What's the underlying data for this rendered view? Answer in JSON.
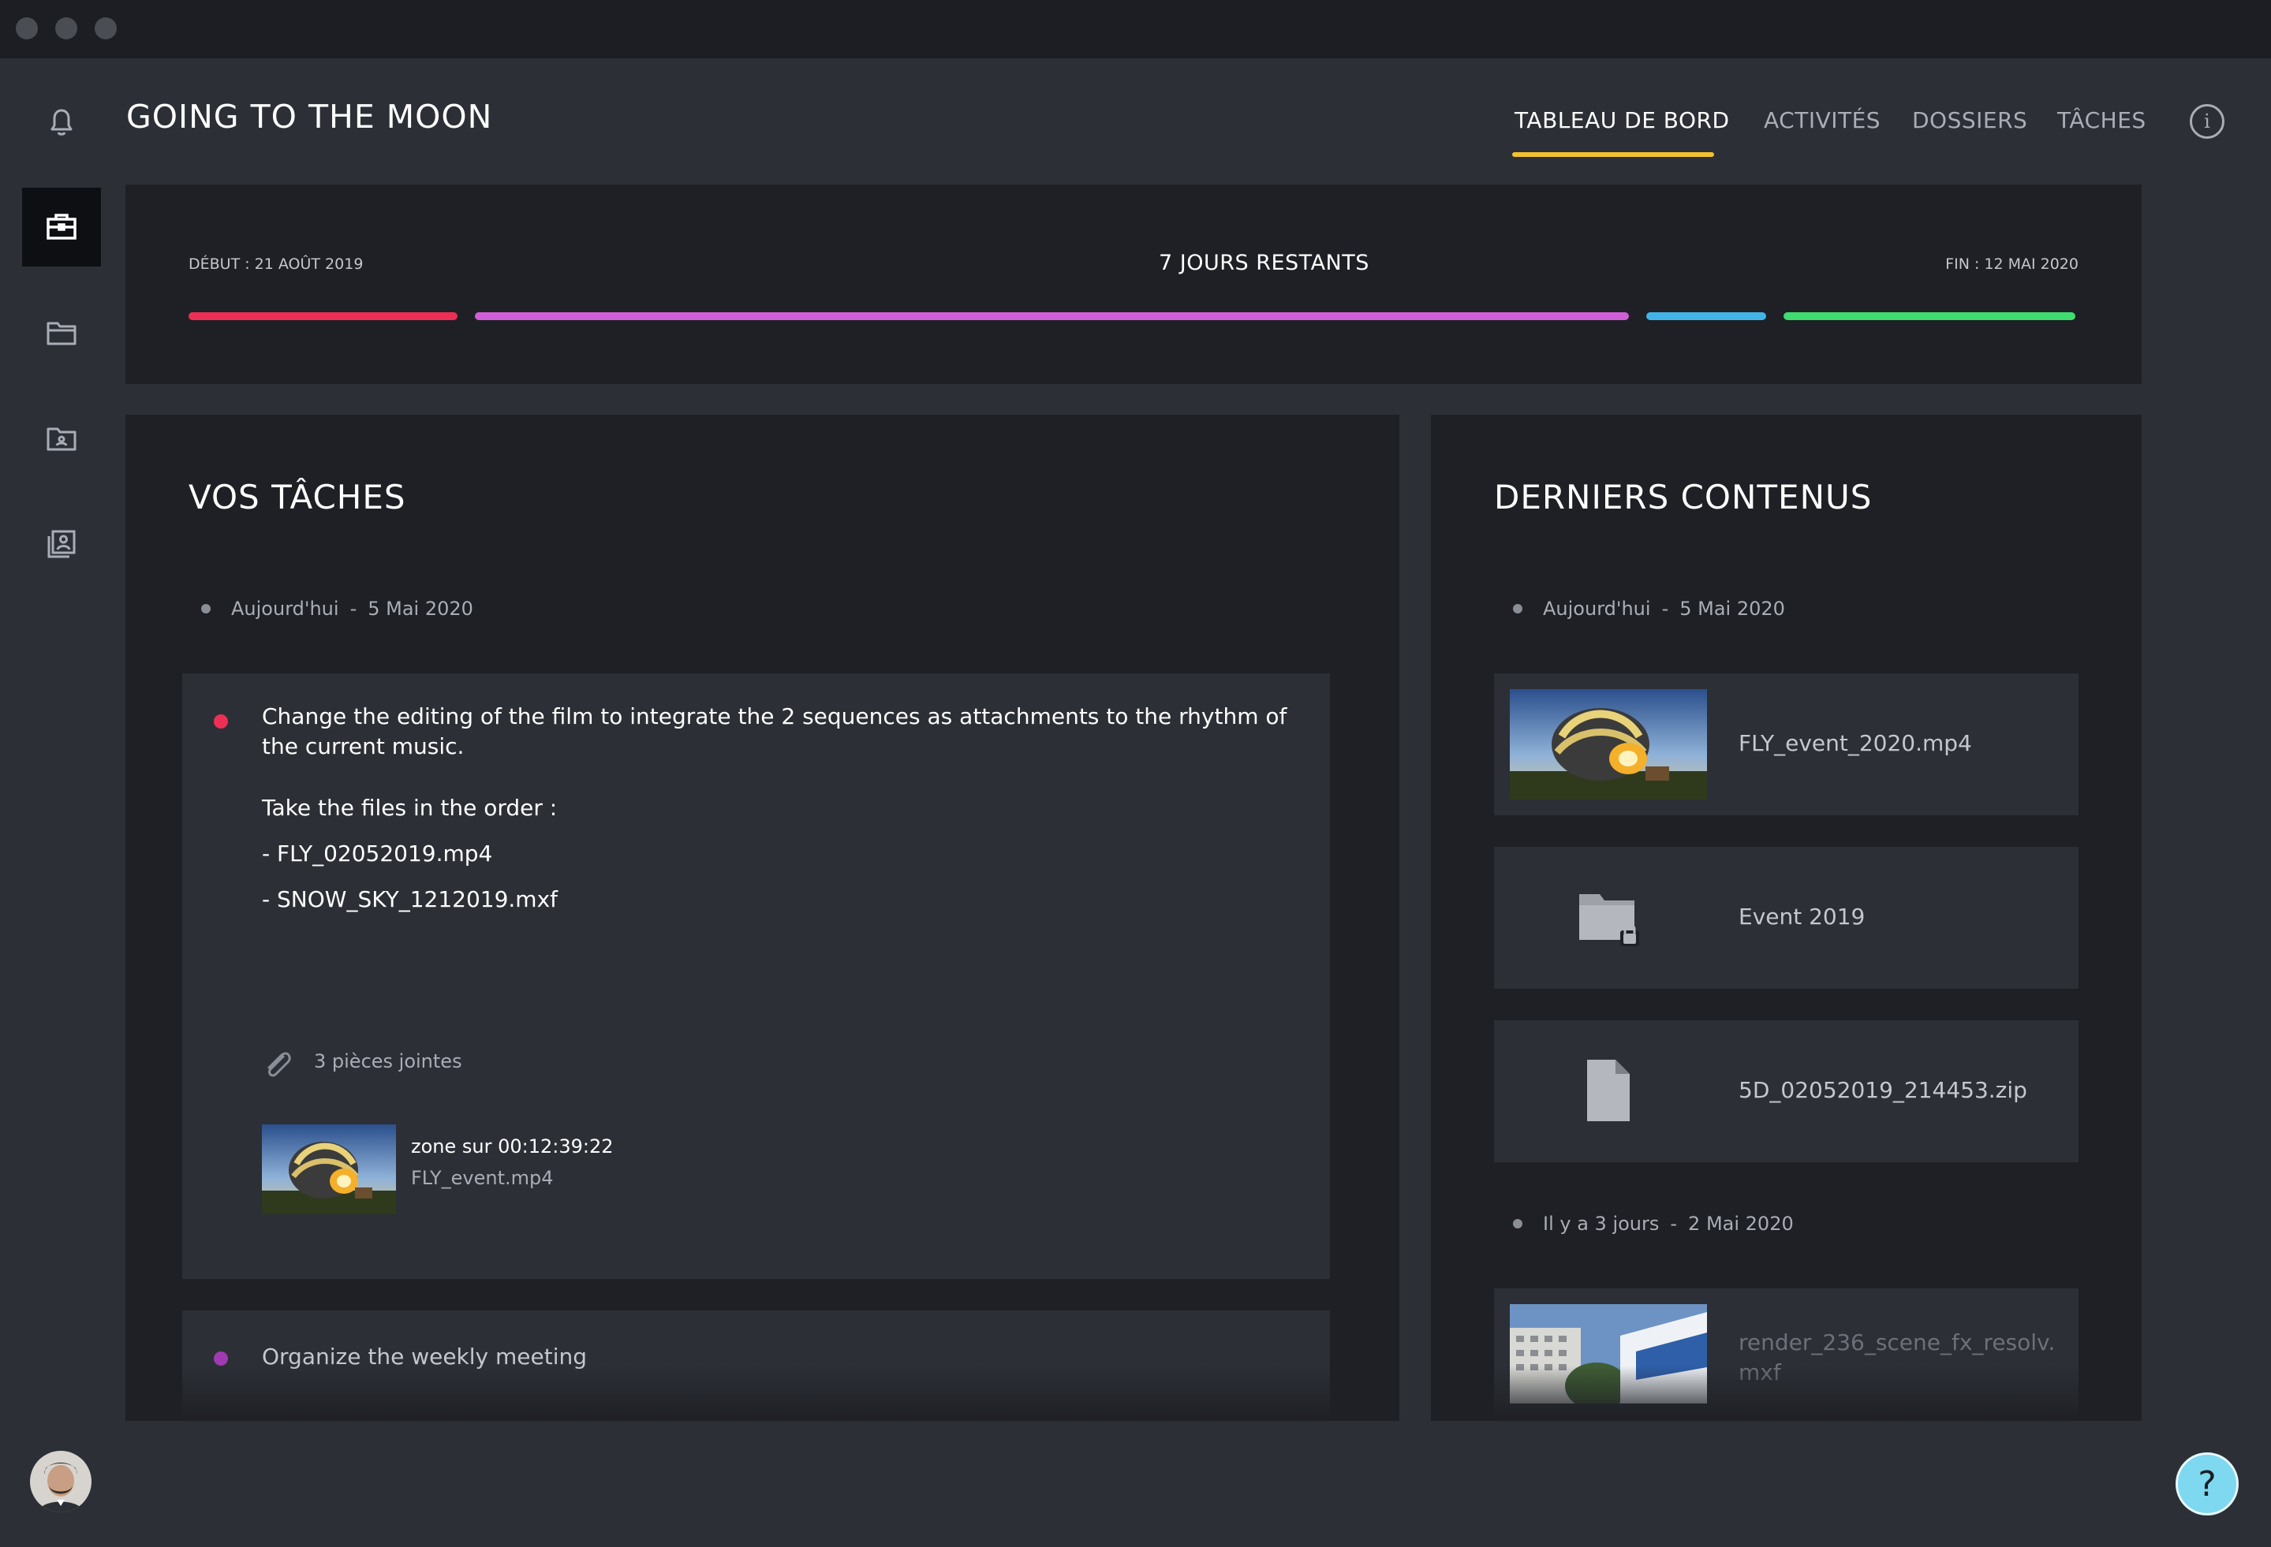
{
  "header": {
    "title": "GOING TO THE MOON",
    "nav": [
      "TABLEAU DE BORD",
      "ACTIVITÉS",
      "DOSSIERS",
      "TÂCHES"
    ],
    "info_glyph": "i"
  },
  "timeline": {
    "start": "DÉBUT : 21 AOÛT 2019",
    "end": "FIN : 12 MAI 2020",
    "remaining": "7 JOURS RESTANTS",
    "phase_colors": [
      "#ee2f55",
      "#cf5fd8",
      "#42b3e6",
      "#3fdc6f"
    ]
  },
  "tasks": {
    "title": "VOS TÂCHES",
    "date_label": "Aujourd'hui",
    "date_sep": "-",
    "date_value": "5 Mai 2020",
    "items": [
      {
        "text": "Change the editing of the film to integrate the 2 sequences as attachments to the rhythm of the current music.",
        "order_label": "Take the files in the order :",
        "file1": "- FLY_02052019.mp4",
        "file2": "- SNOW_SKY_1212019.mxf",
        "attachments": "3 pièces jointes",
        "attachment_zone": "zone sur 00:12:39:22",
        "attachment_file": "FLY_event.mp4",
        "dot_color": "#ee2f55"
      },
      {
        "text": "Organize the weekly meeting",
        "dot_color": "#a03ab0"
      }
    ]
  },
  "contents": {
    "title": "DERNIERS CONTENUS",
    "group1": {
      "label": "Aujourd'hui",
      "sep": "-",
      "date": "5 Mai 2020"
    },
    "items": [
      {
        "name": "FLY_event_2020.mp4",
        "icon": "video-thumbnail"
      },
      {
        "name": "Event 2019",
        "icon": "locked-folder-icon"
      },
      {
        "name": "5D_02052019_214453.zip",
        "icon": "file-icon"
      }
    ],
    "group2": {
      "label": "Il y a 3 jours",
      "sep": "-",
      "date": "2 Mai 2020"
    },
    "item4": {
      "name_line1": "render_236_scene_fx_resolv.",
      "name_line2": "mxf",
      "icon": "image-thumbnail"
    }
  },
  "help": {
    "glyph": "?"
  }
}
